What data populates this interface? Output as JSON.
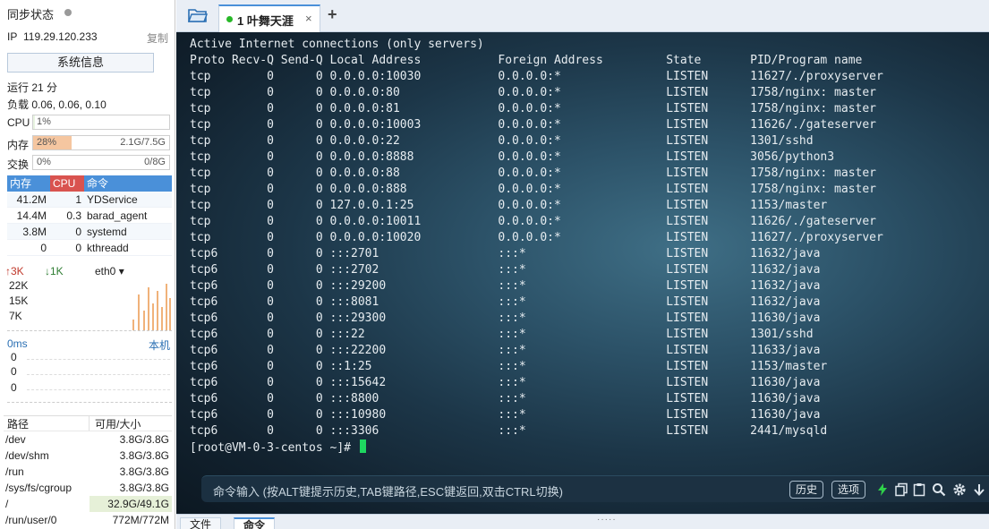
{
  "sidebar": {
    "sync_status": "同步状态",
    "ip_label": "IP",
    "ip_value": "119.29.120.233",
    "copy_label": "复制",
    "sysinfo_button": "系统信息",
    "uptime": "运行 21 分",
    "load": "负载 0.06, 0.06, 0.10",
    "meters": {
      "cpu": {
        "label": "CPU",
        "left": "1%",
        "right": "",
        "percent": 1,
        "color": "#e8f4e0"
      },
      "mem": {
        "label": "内存",
        "left": "28%",
        "right": "2.1G/7.5G",
        "percent": 28,
        "color": "#f5c6a0"
      },
      "swap": {
        "label": "交换",
        "left": "0%",
        "right": "0/8G",
        "percent": 0,
        "color": "#e8f4e0"
      }
    },
    "processes": {
      "headers": {
        "mem": "内存",
        "cpu": "CPU",
        "cmd": "命令"
      },
      "rows": [
        {
          "mem": "41.2M",
          "cpu": "1",
          "cmd": "YDService"
        },
        {
          "mem": "14.4M",
          "cpu": "0.3",
          "cmd": "barad_agent"
        },
        {
          "mem": "3.8M",
          "cpu": "0",
          "cmd": "systemd"
        },
        {
          "mem": "0",
          "cpu": "0",
          "cmd": "kthreadd"
        }
      ]
    },
    "network": {
      "up": "↑3K",
      "down": "↓1K",
      "interface": "eth0 ▾",
      "axis": [
        "22K",
        "15K",
        "7K"
      ]
    },
    "ping": {
      "label": "0ms",
      "host": "本机",
      "values": [
        "0",
        "0",
        "0"
      ]
    },
    "disks": {
      "headers": {
        "path": "路径",
        "size": "可用/大小"
      },
      "rows": [
        {
          "path": "/dev",
          "size": "3.8G/3.8G"
        },
        {
          "path": "/dev/shm",
          "size": "3.8G/3.8G"
        },
        {
          "path": "/run",
          "size": "3.8G/3.8G"
        },
        {
          "path": "/sys/fs/cgroup",
          "size": "3.8G/3.8G"
        },
        {
          "path": "/",
          "size": "32.9G/49.1G"
        },
        {
          "path": "/run/user/0",
          "size": "772M/772M"
        }
      ]
    }
  },
  "tabs": {
    "active_title": "1 叶舞天涯",
    "close_glyph": "×",
    "add_glyph": "+"
  },
  "terminal": {
    "lines": [
      "Active Internet connections (only servers)",
      "Proto Recv-Q Send-Q Local Address           Foreign Address         State       PID/Program name",
      "tcp        0      0 0.0.0.0:10030           0.0.0.0:*               LISTEN      11627/./proxyserver",
      "tcp        0      0 0.0.0.0:80              0.0.0.0:*               LISTEN      1758/nginx: master",
      "tcp        0      0 0.0.0.0:81              0.0.0.0:*               LISTEN      1758/nginx: master",
      "tcp        0      0 0.0.0.0:10003           0.0.0.0:*               LISTEN      11626/./gateserver",
      "tcp        0      0 0.0.0.0:22              0.0.0.0:*               LISTEN      1301/sshd",
      "tcp        0      0 0.0.0.0:8888            0.0.0.0:*               LISTEN      3056/python3",
      "tcp        0      0 0.0.0.0:88              0.0.0.0:*               LISTEN      1758/nginx: master",
      "tcp        0      0 0.0.0.0:888             0.0.0.0:*               LISTEN      1758/nginx: master",
      "tcp        0      0 127.0.0.1:25            0.0.0.0:*               LISTEN      1153/master",
      "tcp        0      0 0.0.0.0:10011           0.0.0.0:*               LISTEN      11626/./gateserver",
      "tcp        0      0 0.0.0.0:10020           0.0.0.0:*               LISTEN      11627/./proxyserver",
      "tcp6       0      0 :::2701                 :::*                    LISTEN      11632/java",
      "tcp6       0      0 :::2702                 :::*                    LISTEN      11632/java",
      "tcp6       0      0 :::29200                :::*                    LISTEN      11632/java",
      "tcp6       0      0 :::8081                 :::*                    LISTEN      11632/java",
      "tcp6       0      0 :::29300                :::*                    LISTEN      11630/java",
      "tcp6       0      0 :::22                   :::*                    LISTEN      1301/sshd",
      "tcp6       0      0 :::22200                :::*                    LISTEN      11633/java",
      "tcp6       0      0 ::1:25                  :::*                    LISTEN      1153/master",
      "tcp6       0      0 :::15642                :::*                    LISTEN      11630/java",
      "tcp6       0      0 :::8800                 :::*                    LISTEN      11630/java",
      "tcp6       0      0 :::10980                :::*                    LISTEN      11630/java",
      "tcp6       0      0 :::3306                 :::*                    LISTEN      2441/mysqld"
    ],
    "prompt": "[root@VM-0-3-centos ~]# "
  },
  "command_bar": {
    "placeholder": "命令输入 (按ALT键提示历史,TAB键路径,ESC键返回,双击CTRL切换)",
    "history_button": "历史",
    "options_button": "选项"
  },
  "bottom_tabs": {
    "files": "文件",
    "commands": "命令"
  }
}
